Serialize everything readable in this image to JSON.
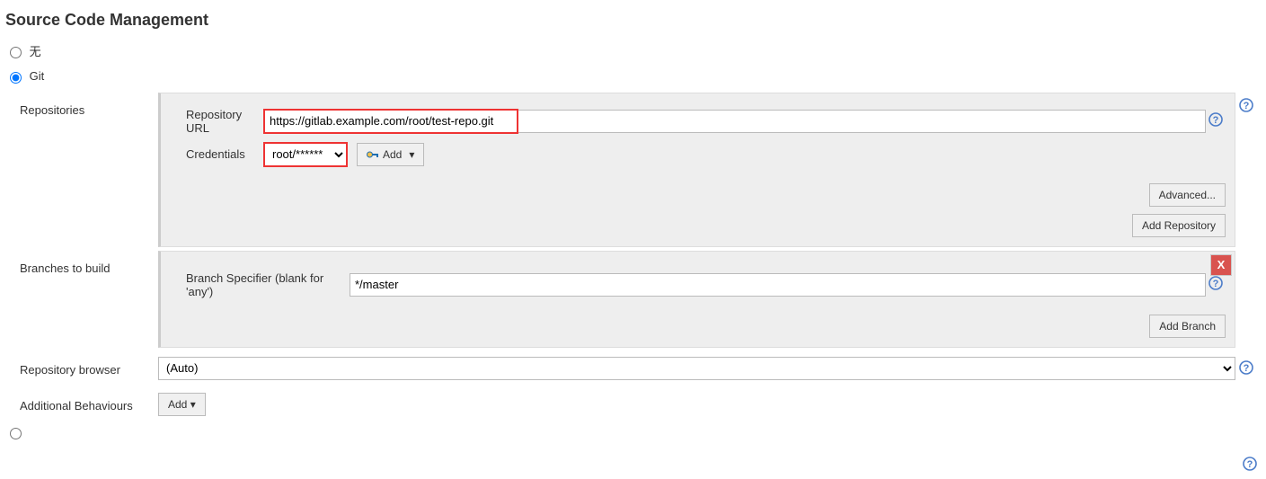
{
  "section_title": "Source Code Management",
  "scm": {
    "none_label": "无",
    "git_label": "Git",
    "selected": "git"
  },
  "repositories": {
    "label": "Repositories",
    "repository_url_label": "Repository URL",
    "repository_url_value": "https://gitlab.example.com/root/test-repo.git",
    "credentials_label": "Credentials",
    "credentials_selected": "root/******",
    "add_credentials_label": "Add",
    "advanced_label": "Advanced...",
    "add_repository_label": "Add Repository"
  },
  "branches": {
    "label": "Branches to build",
    "branch_specifier_label": "Branch Specifier (blank for 'any')",
    "branch_specifier_value": "*/master",
    "close_label": "X",
    "add_branch_label": "Add Branch"
  },
  "repo_browser": {
    "label": "Repository browser",
    "selected": "(Auto)"
  },
  "additional_behaviours": {
    "label": "Additional Behaviours",
    "add_label": "Add"
  }
}
